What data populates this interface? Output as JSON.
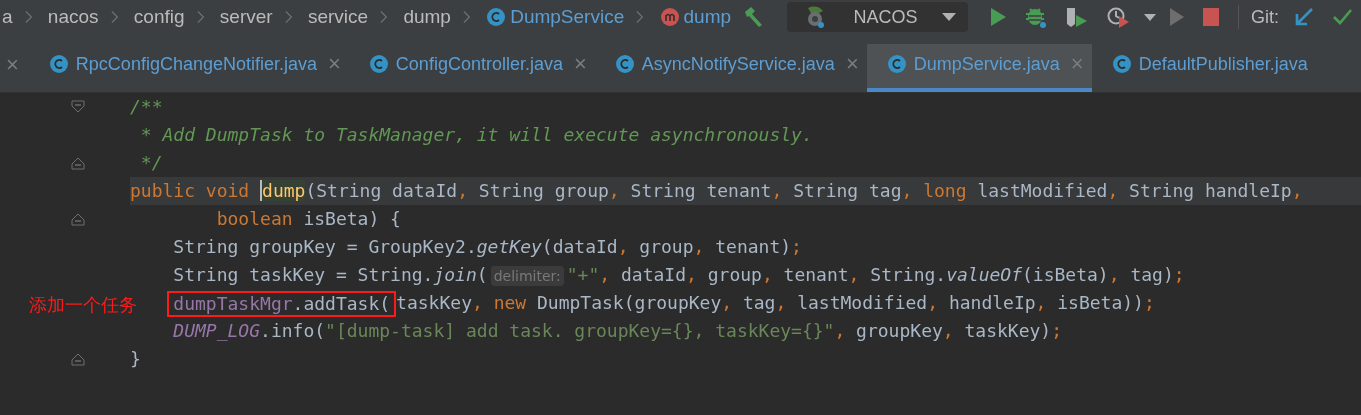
{
  "breadcrumbs": [
    {
      "label": "a",
      "kind": "plain"
    },
    {
      "label": "nacos",
      "kind": "plain"
    },
    {
      "label": "config",
      "kind": "plain"
    },
    {
      "label": "server",
      "kind": "plain"
    },
    {
      "label": "service",
      "kind": "plain"
    },
    {
      "label": "dump",
      "kind": "plain"
    },
    {
      "label": "DumpService",
      "kind": "class"
    },
    {
      "label": "dump",
      "kind": "method"
    }
  ],
  "run_config": {
    "label": "NACOS"
  },
  "git": {
    "label": "Git:"
  },
  "tabs_leading_close": "×",
  "tabs": [
    {
      "label": "RpcConfigChangeNotifier.java",
      "close": "×",
      "selected": false
    },
    {
      "label": "ConfigController.java",
      "close": "×",
      "selected": false
    },
    {
      "label": "AsyncNotifyService.java",
      "close": "×",
      "selected": false
    },
    {
      "label": "DumpService.java",
      "close": "×",
      "selected": true
    },
    {
      "label": "DefaultPublisher.java",
      "selected": false
    }
  ],
  "code": [
    {
      "kind": "fold-start",
      "current": false,
      "indented": false,
      "tokens": [
        {
          "text": "/**",
          "kind": "doc"
        }
      ]
    },
    {
      "kind": "plain",
      "current": false,
      "indented": false,
      "tokens": [
        {
          "text": " * Add DumpTask to TaskManager, it will execute asynchronously.",
          "kind": "doc"
        }
      ]
    },
    {
      "kind": "fold-end",
      "current": false,
      "indented": false,
      "tokens": [
        {
          "text": " */",
          "kind": "doc"
        }
      ]
    },
    {
      "kind": "plain",
      "current": true,
      "indented": false,
      "tokens": [
        {
          "text": "public void ",
          "kind": "keyword"
        },
        {
          "text": "dump",
          "kind": "declaration",
          "caret": true
        },
        {
          "text": "(String dataId",
          "kind": "plain"
        },
        {
          "text": ", ",
          "kind": "keyword"
        },
        {
          "text": "String group",
          "kind": "plain"
        },
        {
          "text": ", ",
          "kind": "keyword"
        },
        {
          "text": "String tenant",
          "kind": "plain"
        },
        {
          "text": ", ",
          "kind": "keyword"
        },
        {
          "text": "String tag",
          "kind": "plain"
        },
        {
          "text": ", ",
          "kind": "keyword"
        },
        {
          "text": "long ",
          "kind": "keyword"
        },
        {
          "text": "lastModified",
          "kind": "plain"
        },
        {
          "text": ", ",
          "kind": "keyword"
        },
        {
          "text": "String handleIp",
          "kind": "plain"
        },
        {
          "text": ",",
          "kind": "keyword"
        }
      ]
    },
    {
      "kind": "fold-end",
      "current": false,
      "indented": false,
      "tokens": [
        {
          "text": "        boolean ",
          "kind": "keyword"
        },
        {
          "text": "isBeta) {",
          "kind": "plain"
        }
      ]
    },
    {
      "kind": "plain",
      "current": false,
      "indented": true,
      "tokens": [
        {
          "text": "String groupKey = GroupKey2.",
          "kind": "plain"
        },
        {
          "text": "getKey",
          "kind": "static"
        },
        {
          "text": "(dataId",
          "kind": "plain"
        },
        {
          "text": ", ",
          "kind": "keyword"
        },
        {
          "text": "group",
          "kind": "plain"
        },
        {
          "text": ", ",
          "kind": "keyword"
        },
        {
          "text": "tenant)",
          "kind": "plain"
        },
        {
          "text": ";",
          "kind": "keyword"
        }
      ]
    },
    {
      "kind": "plain",
      "current": false,
      "indented": true,
      "tokens": [
        {
          "text": "String taskKey = String.",
          "kind": "plain"
        },
        {
          "text": "join",
          "kind": "static"
        },
        {
          "text": "(",
          "kind": "plain"
        },
        {
          "text": "delimiter:",
          "kind": "hint"
        },
        {
          "text": "\"+\"",
          "kind": "string"
        },
        {
          "text": ", ",
          "kind": "keyword"
        },
        {
          "text": "dataId",
          "kind": "plain"
        },
        {
          "text": ", ",
          "kind": "keyword"
        },
        {
          "text": "group",
          "kind": "plain"
        },
        {
          "text": ", ",
          "kind": "keyword"
        },
        {
          "text": "tenant",
          "kind": "plain"
        },
        {
          "text": ", ",
          "kind": "keyword"
        },
        {
          "text": "String.",
          "kind": "plain"
        },
        {
          "text": "valueOf",
          "kind": "static"
        },
        {
          "text": "(isBeta)",
          "kind": "plain"
        },
        {
          "text": ", ",
          "kind": "keyword"
        },
        {
          "text": "tag)",
          "kind": "plain"
        },
        {
          "text": ";",
          "kind": "keyword"
        }
      ]
    },
    {
      "kind": "plain",
      "current": false,
      "indented": true,
      "annotation": "添加一个任务",
      "tokens": [
        {
          "text": "dumpTaskMgr",
          "kind": "field",
          "boxed": true
        },
        {
          "text": ".addTask(",
          "kind": "plain",
          "boxed": true
        },
        {
          "text": "taskKey",
          "kind": "plain",
          "boxed": false
        },
        {
          "text": ", ",
          "kind": "keyword",
          "boxed": false
        },
        {
          "text": "new ",
          "kind": "keyword",
          "boxed": false
        },
        {
          "text": "DumpTask(groupKey",
          "kind": "plain",
          "boxed": false
        },
        {
          "text": ", ",
          "kind": "keyword",
          "boxed": false
        },
        {
          "text": "tag",
          "kind": "plain",
          "boxed": false
        },
        {
          "text": ", ",
          "kind": "keyword",
          "boxed": false
        },
        {
          "text": "lastModified",
          "kind": "plain",
          "boxed": false
        },
        {
          "text": ", ",
          "kind": "keyword",
          "boxed": false
        },
        {
          "text": "handleIp",
          "kind": "plain",
          "boxed": false
        },
        {
          "text": ", ",
          "kind": "keyword",
          "boxed": false
        },
        {
          "text": "isBeta))",
          "kind": "plain",
          "boxed": false
        },
        {
          "text": ";",
          "kind": "keyword",
          "boxed": false
        }
      ]
    },
    {
      "kind": "plain",
      "current": false,
      "indented": true,
      "tokens": [
        {
          "text": "DUMP_LOG",
          "kind": "static-field"
        },
        {
          "text": ".info(",
          "kind": "plain"
        },
        {
          "text": "\"[dump-task] add task. groupKey={}, taskKey={}\"",
          "kind": "string"
        },
        {
          "text": ", ",
          "kind": "keyword"
        },
        {
          "text": "groupKey",
          "kind": "plain"
        },
        {
          "text": ", ",
          "kind": "keyword"
        },
        {
          "text": "taskKey)",
          "kind": "plain"
        },
        {
          "text": ";",
          "kind": "keyword"
        }
      ]
    },
    {
      "kind": "fold-end",
      "current": false,
      "indented": false,
      "tokens": [
        {
          "text": "}",
          "kind": "plain"
        }
      ]
    }
  ]
}
